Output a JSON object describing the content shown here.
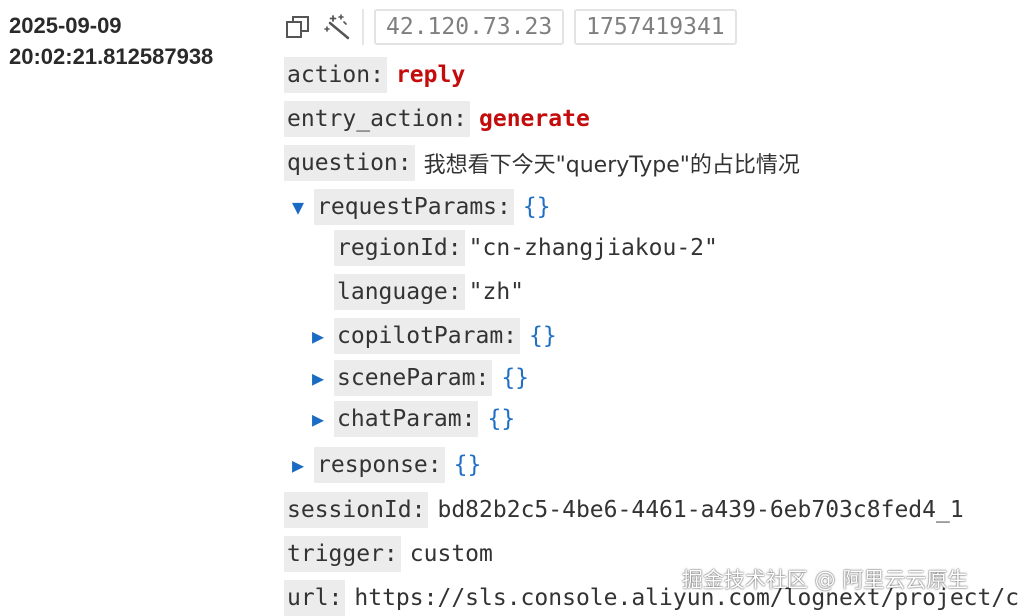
{
  "timestamp": {
    "date": "2025-09-09",
    "time": "20:02:21.812587938"
  },
  "toolbar": {
    "copy_icon": "copy-icon",
    "magic_icon": "magic-wand-icon",
    "tags": [
      "42.120.73.23",
      "1757419341"
    ]
  },
  "fields": {
    "action": {
      "key": "action:",
      "value": "reply"
    },
    "entry_action": {
      "key": "entry_action:",
      "value": "generate"
    },
    "question": {
      "key": "question:",
      "value": "我想看下今天\"queryType\"的占比情况"
    },
    "requestParams": {
      "key": "requestParams:",
      "value": "{}",
      "expanded": true,
      "children": {
        "regionId": {
          "key": "regionId:",
          "value": "\"cn-zhangjiakou-2\""
        },
        "language": {
          "key": "language:",
          "value": "\"zh\""
        },
        "copilotParam": {
          "key": "copilotParam:",
          "value": "{}",
          "expanded": false
        },
        "sceneParam": {
          "key": "sceneParam:",
          "value": "{}",
          "expanded": false
        },
        "chatParam": {
          "key": "chatParam:",
          "value": "{}",
          "expanded": false
        }
      }
    },
    "response": {
      "key": "response:",
      "value": "{}",
      "expanded": false
    },
    "sessionId": {
      "key": "sessionId:",
      "value": "bd82b2c5-4be6-4461-a439-6eb703c8fed4_1"
    },
    "trigger": {
      "key": "trigger:",
      "value": "custom"
    },
    "url": {
      "key": "url:",
      "value": "https://sls.console.aliyun.com/lognext/project/c"
    }
  },
  "toggle_glyphs": {
    "expanded": "▼",
    "collapsed": "▶"
  },
  "colors": {
    "key_bg": "#ececec",
    "red_value": "#c40c0c",
    "brace": "#1f6fc4",
    "toggle": "#1a6bc4"
  },
  "watermark": "掘金技术社区 @ 阿里云云原生"
}
